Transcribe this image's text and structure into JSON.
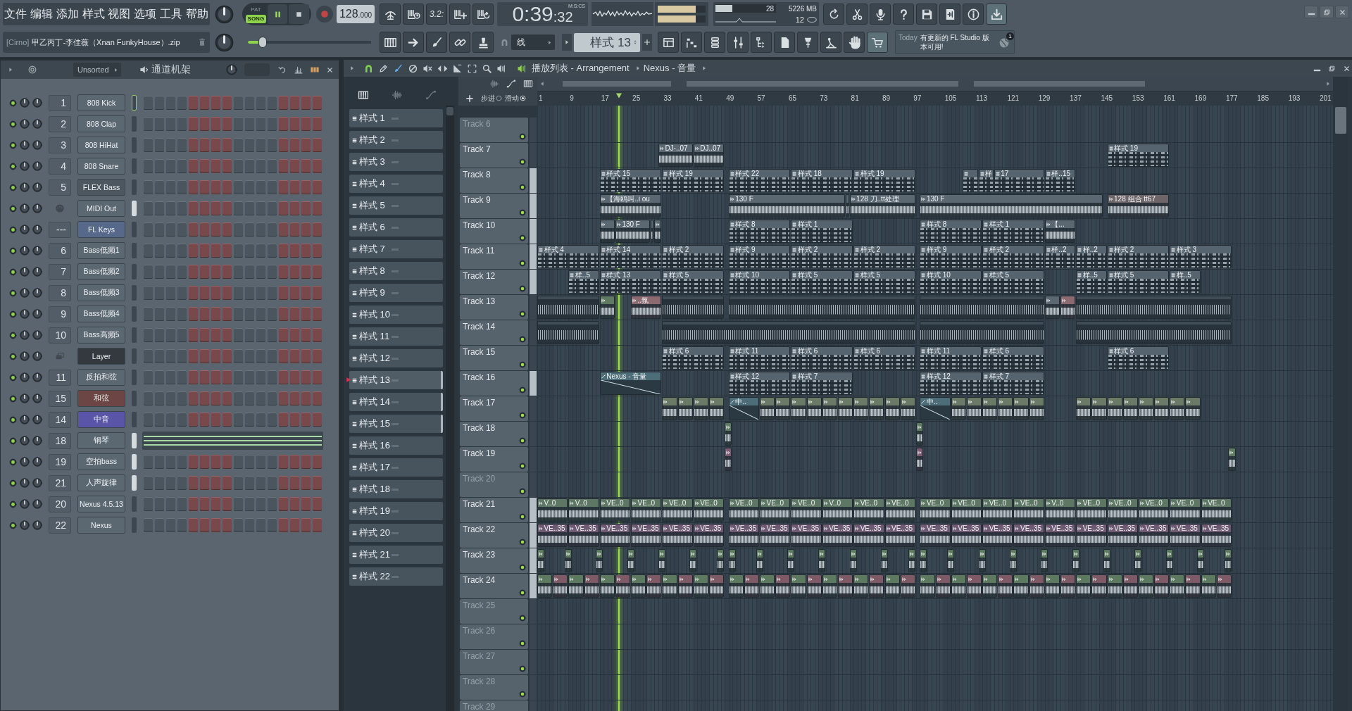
{
  "menu": [
    "文件",
    "编辑",
    "添加",
    "样式",
    "视图",
    "选项",
    "工具",
    "帮助"
  ],
  "hint": {
    "tag": "[Cirno]",
    "text": "甲乙丙丁-李佳薇（Xnan FunkyHouse）.zip"
  },
  "transport": {
    "modes": [
      {
        "label": "PAT",
        "selected": false
      },
      {
        "label": "SONG",
        "selected": true
      }
    ],
    "playing": true,
    "recording": false,
    "tempo": "128",
    "tempo_decimals": ".000"
  },
  "master_slider": {
    "level": 0.12
  },
  "countdown": "3.2:",
  "time": {
    "value": "0:39",
    "centiseconds": ":32",
    "format": "M:S:CS"
  },
  "output_meter": [
    {
      "level": 0.8
    },
    {
      "level": 0.8
    }
  ],
  "monitor": {
    "cpu": "28",
    "cpu_meter": {
      "level": 0.28
    },
    "memory": "5226 MB",
    "polyphony": "12"
  },
  "snap": "线",
  "pattern": "样式 13",
  "news": {
    "date": "Today",
    "message": "有更新的 FL Studio 版本可用!",
    "badge": "1"
  },
  "channel_rack": {
    "filter": "Unsorted",
    "title": "通道机架",
    "channels": [
      {
        "insert": "1",
        "name": "808 Kick",
        "kind": "channel",
        "color": "#5b6771",
        "on": true,
        "selected": false,
        "focused": true,
        "steps": [
          false,
          false,
          false,
          false,
          false,
          false,
          false,
          false,
          false,
          false,
          false,
          false,
          false,
          false,
          false,
          false
        ]
      },
      {
        "insert": "2",
        "name": "808 Clap",
        "kind": "channel",
        "color": "#5b6771",
        "on": true,
        "selected": false,
        "focused": false,
        "steps": [
          false,
          false,
          false,
          false,
          false,
          false,
          false,
          false,
          false,
          false,
          false,
          false,
          false,
          false,
          false,
          false
        ]
      },
      {
        "insert": "3",
        "name": "808 HiHat",
        "kind": "channel",
        "color": "#5b6771",
        "on": true,
        "selected": false,
        "focused": false,
        "steps": [
          false,
          false,
          false,
          false,
          false,
          false,
          false,
          false,
          false,
          false,
          false,
          false,
          false,
          false,
          false,
          false
        ]
      },
      {
        "insert": "4",
        "name": "808 Snare",
        "kind": "channel",
        "color": "#5b6771",
        "on": true,
        "selected": false,
        "focused": false,
        "steps": [
          false,
          false,
          false,
          false,
          false,
          false,
          false,
          false,
          false,
          false,
          false,
          false,
          false,
          false,
          false,
          false
        ]
      },
      {
        "insert": "5",
        "name": "FLEX Bass",
        "kind": "channel",
        "color": "#4d5760",
        "on": true,
        "selected": false,
        "focused": false,
        "steps": [
          false,
          false,
          false,
          false,
          false,
          false,
          false,
          false,
          false,
          false,
          false,
          false,
          false,
          false,
          false,
          false
        ]
      },
      {
        "name": "MIDI Out",
        "kind": "midi",
        "color": "#5b6771",
        "on": true,
        "selected": true,
        "focused": false,
        "steps": [
          false,
          false,
          false,
          false,
          false,
          false,
          false,
          false,
          false,
          false,
          false,
          false,
          false,
          false,
          false,
          false
        ]
      },
      {
        "insert": "---",
        "name": "FL Keys",
        "kind": "channel",
        "color": "#56698a",
        "on": true,
        "selected": false,
        "focused": false,
        "steps": [
          false,
          false,
          false,
          false,
          false,
          false,
          false,
          false,
          false,
          false,
          false,
          false,
          false,
          false,
          false,
          false
        ]
      },
      {
        "insert": "6",
        "name": "Bass低频1",
        "kind": "channel",
        "color": "#5b6771",
        "on": true,
        "selected": false,
        "focused": false,
        "steps": [
          false,
          false,
          false,
          false,
          false,
          false,
          false,
          false,
          false,
          false,
          false,
          false,
          false,
          false,
          false,
          false
        ]
      },
      {
        "insert": "7",
        "name": "Bass低频2",
        "kind": "channel",
        "color": "#5b6771",
        "on": true,
        "selected": false,
        "focused": false,
        "steps": [
          false,
          false,
          false,
          false,
          false,
          false,
          false,
          false,
          false,
          false,
          false,
          false,
          false,
          false,
          false,
          false
        ]
      },
      {
        "insert": "8",
        "name": "Bass低频3",
        "kind": "channel",
        "color": "#5b6771",
        "on": true,
        "selected": false,
        "focused": false,
        "steps": [
          false,
          false,
          false,
          false,
          false,
          false,
          false,
          false,
          false,
          false,
          false,
          false,
          false,
          false,
          false,
          false
        ]
      },
      {
        "insert": "9",
        "name": "Bass低频4",
        "kind": "channel",
        "color": "#5b6771",
        "on": true,
        "selected": false,
        "focused": false,
        "steps": [
          false,
          false,
          false,
          false,
          false,
          false,
          false,
          false,
          false,
          false,
          false,
          false,
          false,
          false,
          false,
          false
        ]
      },
      {
        "insert": "10",
        "name": "Bass高频5",
        "kind": "channel",
        "color": "#5b6771",
        "on": true,
        "selected": false,
        "focused": false,
        "steps": [
          false,
          false,
          false,
          false,
          false,
          false,
          false,
          false,
          false,
          false,
          false,
          false,
          false,
          false,
          false,
          false
        ]
      },
      {
        "name": "Layer",
        "kind": "layer",
        "color": "#33393f",
        "on": true,
        "selected": false,
        "focused": false,
        "steps": [
          false,
          false,
          false,
          false,
          false,
          false,
          false,
          false,
          false,
          false,
          false,
          false,
          false,
          false,
          false,
          false
        ]
      },
      {
        "insert": "11",
        "name": "反拍和弦",
        "kind": "channel",
        "color": "#5b6771",
        "on": true,
        "selected": false,
        "focused": false,
        "steps": [
          false,
          false,
          false,
          false,
          false,
          false,
          false,
          false,
          false,
          false,
          false,
          false,
          false,
          false,
          false,
          false
        ]
      },
      {
        "insert": "15",
        "name": "和弦",
        "kind": "channel",
        "color": "#6b4644",
        "on": true,
        "selected": false,
        "focused": false,
        "steps": [
          false,
          false,
          false,
          false,
          false,
          false,
          false,
          false,
          false,
          false,
          false,
          false,
          false,
          false,
          false,
          false
        ]
      },
      {
        "insert": "14",
        "name": "中音",
        "kind": "channel",
        "color": "#5b55a8",
        "on": true,
        "selected": false,
        "focused": false,
        "steps": [
          false,
          false,
          false,
          false,
          false,
          false,
          false,
          false,
          false,
          false,
          false,
          false,
          false,
          false,
          false,
          false
        ]
      },
      {
        "insert": "18",
        "name": "钢琴",
        "kind": "channel",
        "color": "#5b6771",
        "on": true,
        "selected": true,
        "focused": false,
        "piano_roll": true
      },
      {
        "insert": "19",
        "name": "空拍bass",
        "kind": "channel",
        "color": "#5b6771",
        "on": true,
        "selected": true,
        "focused": false,
        "steps": [
          false,
          false,
          false,
          false,
          false,
          false,
          false,
          false,
          false,
          false,
          false,
          false,
          false,
          false,
          false,
          false
        ]
      },
      {
        "insert": "21",
        "name": "人声旋律",
        "kind": "channel",
        "color": "#5b6771",
        "on": true,
        "selected": true,
        "focused": false,
        "steps": [
          false,
          false,
          false,
          false,
          false,
          false,
          false,
          false,
          false,
          false,
          false,
          false,
          false,
          false,
          false,
          false
        ]
      },
      {
        "insert": "20",
        "name": "Nexus 4.5.13",
        "kind": "channel",
        "color": "#5b6771",
        "on": true,
        "selected": false,
        "focused": false,
        "steps": [
          false,
          false,
          false,
          false,
          false,
          false,
          false,
          false,
          false,
          false,
          false,
          false,
          false,
          false,
          false,
          false
        ]
      },
      {
        "insert": "22",
        "name": "Nexus",
        "kind": "channel",
        "color": "#5b6771",
        "on": true,
        "selected": false,
        "focused": false,
        "steps": [
          false,
          false,
          false,
          false,
          false,
          false,
          false,
          false,
          false,
          false,
          false,
          false,
          false,
          false,
          false,
          false
        ]
      }
    ]
  },
  "playlist": {
    "title": "播放列表 - Arrangement",
    "crumb": "Nexus - 音量",
    "toggles": [
      {
        "label": "步进",
        "on": false
      },
      {
        "label": "滑动",
        "on": true
      }
    ],
    "patterns": [
      {
        "name": "样式 1",
        "selected": false,
        "marked": false
      },
      {
        "name": "样式 2",
        "selected": false,
        "marked": false
      },
      {
        "name": "样式 3",
        "selected": false,
        "marked": false
      },
      {
        "name": "样式 4",
        "selected": false,
        "marked": false
      },
      {
        "name": "样式 5",
        "selected": false,
        "marked": false
      },
      {
        "name": "样式 6",
        "selected": false,
        "marked": false
      },
      {
        "name": "样式 7",
        "selected": false,
        "marked": false
      },
      {
        "name": "样式 8",
        "selected": false,
        "marked": false
      },
      {
        "name": "样式 9",
        "selected": false,
        "marked": false
      },
      {
        "name": "样式 10",
        "selected": false,
        "marked": false
      },
      {
        "name": "样式 11",
        "selected": false,
        "marked": false
      },
      {
        "name": "样式 12",
        "selected": false,
        "marked": false
      },
      {
        "name": "样式 13",
        "selected": true,
        "marked": true
      },
      {
        "name": "样式 14",
        "selected": false,
        "marked": true
      },
      {
        "name": "样式 15",
        "selected": false,
        "marked": true
      },
      {
        "name": "样式 16",
        "selected": false,
        "marked": false
      },
      {
        "name": "样式 17",
        "selected": false,
        "marked": false
      },
      {
        "name": "样式 18",
        "selected": false,
        "marked": false
      },
      {
        "name": "样式 19",
        "selected": false,
        "marked": false
      },
      {
        "name": "样式 20",
        "selected": false,
        "marked": false
      },
      {
        "name": "样式 21",
        "selected": false,
        "marked": false
      },
      {
        "name": "样式 22",
        "selected": false,
        "marked": false
      }
    ],
    "ruler": [
      "1",
      "9",
      "17",
      "25",
      "33",
      "41",
      "49",
      "57",
      "65",
      "73",
      "81",
      "89",
      "97",
      "105",
      "113",
      "121",
      "129",
      "137",
      "145",
      "153",
      "161",
      "169",
      "177",
      "185",
      "193",
      "201"
    ],
    "tracks": [
      {
        "name": "Track 6",
        "on": true,
        "dimmed": true,
        "marked": false
      },
      {
        "name": "Track 7",
        "on": true,
        "dimmed": false,
        "marked": false,
        "clips": [
          {
            "kind": "audio",
            "label": "DJ-..07"
          },
          {
            "kind": "audio",
            "label": "DJ..07"
          },
          {
            "kind": "pattern",
            "label": "样式 19"
          }
        ]
      },
      {
        "name": "Track 8",
        "on": true,
        "dimmed": false,
        "marked": true,
        "clips": [
          {
            "kind": "pattern",
            "label": "样式 15"
          },
          {
            "kind": "pattern",
            "label": "样式 19"
          },
          {
            "kind": "pattern",
            "label": "样式 22"
          },
          {
            "kind": "pattern",
            "label": "样式 18"
          },
          {
            "kind": "pattern",
            "label": "样式 19"
          },
          {
            "kind": "pattern"
          },
          {
            "kind": "pattern",
            "label": "样"
          },
          {
            "kind": "pattern",
            "label": "17"
          },
          {
            "kind": "pattern",
            "label": "样..15"
          }
        ]
      },
      {
        "name": "Track 9",
        "on": true,
        "dimmed": false,
        "marked": true,
        "clips": [
          {
            "kind": "audio",
            "label": "【海鸥叫..i ou"
          },
          {
            "kind": "audio",
            "label": "130 F"
          },
          {
            "kind": "audio"
          },
          {
            "kind": "audio",
            "label": "128 刀..tt处理"
          },
          {
            "kind": "audio",
            "label": "130 F"
          },
          {
            "kind": "audio",
            "label": "128 组合 tt67",
            "color": "#6e6569"
          }
        ]
      },
      {
        "name": "Track 10",
        "on": true,
        "dimmed": false,
        "marked": true,
        "clips": [
          {
            "kind": "audio"
          },
          {
            "kind": "audio",
            "label": "130 F"
          },
          {
            "kind": "audio"
          },
          {
            "kind": "audio"
          },
          {
            "kind": "pattern",
            "label": "样式 8"
          },
          {
            "kind": "pattern",
            "label": "样式 1"
          },
          {
            "kind": "pattern",
            "label": "样式 8"
          },
          {
            "kind": "pattern",
            "label": "样式 1"
          },
          {
            "kind": "audio",
            "label": "【..."
          }
        ]
      },
      {
        "name": "Track 11",
        "on": true,
        "dimmed": false,
        "marked": true,
        "clips": [
          {
            "kind": "pattern",
            "label": "样式 4"
          },
          {
            "kind": "pattern",
            "label": "样式 14"
          },
          {
            "kind": "pattern",
            "label": "样式 2"
          },
          {
            "kind": "pattern",
            "label": "样式 9"
          },
          {
            "kind": "pattern",
            "label": "样式 2"
          },
          {
            "kind": "pattern",
            "label": "样式 2"
          },
          {
            "kind": "pattern",
            "label": "样式 9"
          },
          {
            "kind": "pattern",
            "label": "样式 2"
          },
          {
            "kind": "pattern",
            "label": "样..2"
          },
          {
            "kind": "pattern",
            "label": "样..2"
          },
          {
            "kind": "pattern",
            "label": "样式 2"
          },
          {
            "kind": "pattern",
            "label": "样式 3"
          }
        ]
      },
      {
        "name": "Track 12",
        "on": true,
        "dimmed": false,
        "marked": true,
        "clips": [
          {
            "kind": "pattern",
            "label": "样..5"
          },
          {
            "kind": "pattern",
            "label": "样式 13"
          },
          {
            "kind": "pattern",
            "label": "样式 5"
          },
          {
            "kind": "pattern",
            "label": "样式 10"
          },
          {
            "kind": "pattern",
            "label": "样式 5"
          },
          {
            "kind": "pattern",
            "label": "样式 5"
          },
          {
            "kind": "pattern",
            "label": "样式 10"
          },
          {
            "kind": "pattern",
            "label": "样式 5"
          },
          {
            "kind": "pattern",
            "label": "样..5"
          },
          {
            "kind": "pattern",
            "label": "样式 5"
          },
          {
            "kind": "pattern",
            "label": "样..5"
          }
        ]
      },
      {
        "name": "Track 13",
        "on": true,
        "dimmed": false,
        "marked": false,
        "clips": [
          {
            "kind": "sliced"
          },
          {
            "kind": "audio",
            "color": "#5f7a62"
          },
          {
            "kind": "audio",
            "label": "..氛",
            "color": "#8b6a72"
          },
          {
            "kind": "sliced"
          },
          {
            "kind": "sliced"
          },
          {
            "kind": "sliced"
          },
          {
            "kind": "audio"
          },
          {
            "kind": "audio",
            "color": "#8b6a72"
          },
          {
            "kind": "sliced"
          }
        ]
      },
      {
        "name": "Track 14",
        "on": true,
        "dimmed": false,
        "marked": false,
        "clips": [
          {
            "kind": "sliced"
          },
          {
            "kind": "sliced"
          },
          {
            "kind": "sliced"
          },
          {
            "kind": "sliced"
          }
        ]
      },
      {
        "name": "Track 15",
        "on": true,
        "dimmed": false,
        "marked": false,
        "clips": [
          {
            "kind": "pattern",
            "label": "样式 6"
          },
          {
            "kind": "pattern",
            "label": "样式 11"
          },
          {
            "kind": "pattern",
            "label": "样式 6"
          },
          {
            "kind": "pattern",
            "label": "样式 6"
          },
          {
            "kind": "pattern",
            "label": "样式 11"
          },
          {
            "kind": "pattern",
            "label": "样式 6"
          },
          {
            "kind": "pattern",
            "label": "样式 6"
          }
        ]
      },
      {
        "name": "Track 16",
        "on": true,
        "dimmed": false,
        "marked": true,
        "clips": [
          {
            "kind": "automation",
            "label": "Nexus - 音量"
          },
          {
            "kind": "pattern",
            "label": "样式 12"
          },
          {
            "kind": "pattern",
            "label": "样式 7"
          },
          {
            "kind": "pattern",
            "label": "样式 12"
          },
          {
            "kind": "pattern",
            "label": "样式 7"
          }
        ]
      },
      {
        "name": "Track 17",
        "on": true,
        "dimmed": false,
        "marked": false,
        "clips": [
          {
            "kind": "audio",
            "color": "#6a7a67"
          },
          {
            "kind": "audio",
            "color": "#6a7a67"
          },
          {
            "kind": "audio",
            "color": "#6a7a67"
          },
          {
            "kind": "audio",
            "color": "#6a7a67"
          },
          {
            "kind": "automation",
            "label": "中.."
          },
          {
            "kind": "audio",
            "color": "#6a7a67"
          },
          {
            "kind": "audio",
            "color": "#6a7a67"
          },
          {
            "kind": "audio",
            "color": "#6a7a67"
          },
          {
            "kind": "audio",
            "color": "#6a7a67"
          },
          {
            "kind": "audio",
            "color": "#6a7a67"
          },
          {
            "kind": "audio",
            "color": "#6a7a67"
          },
          {
            "kind": "audio",
            "color": "#6a7a67"
          },
          {
            "kind": "audio",
            "color": "#6a7a67"
          },
          {
            "kind": "audio",
            "color": "#6a7a67"
          },
          {
            "kind": "audio",
            "color": "#6a7a67"
          },
          {
            "kind": "automation",
            "label": "中.."
          },
          {
            "kind": "audio",
            "color": "#6a7a67"
          },
          {
            "kind": "audio",
            "color": "#6a7a67"
          },
          {
            "kind": "audio",
            "color": "#6a7a67"
          },
          {
            "kind": "audio",
            "color": "#6a7a67"
          },
          {
            "kind": "audio",
            "color": "#6a7a67"
          },
          {
            "kind": "audio",
            "color": "#6a7a67"
          },
          {
            "kind": "audio",
            "color": "#6a7a67"
          },
          {
            "kind": "audio",
            "color": "#6a7a67"
          },
          {
            "kind": "audio",
            "color": "#6a7a67"
          },
          {
            "kind": "audio",
            "color": "#6a7a67"
          },
          {
            "kind": "audio",
            "color": "#6a7a67"
          },
          {
            "kind": "audio",
            "color": "#6a7a67"
          },
          {
            "kind": "audio",
            "color": "#6a7a67"
          },
          {
            "kind": "audio",
            "color": "#6a7a67"
          }
        ]
      },
      {
        "name": "Track 18",
        "on": true,
        "dimmed": false,
        "marked": false,
        "clips": [
          {
            "kind": "audio",
            "color": "#5f7a62"
          },
          {
            "kind": "audio",
            "color": "#5f7a62"
          }
        ]
      },
      {
        "name": "Track 19",
        "on": true,
        "dimmed": false,
        "marked": false,
        "clips": [
          {
            "kind": "audio",
            "color": "#7c5b74"
          },
          {
            "kind": "audio",
            "color": "#7c5b74"
          },
          {
            "kind": "audio",
            "color": "#5f7a62"
          }
        ]
      },
      {
        "name": "Track 20",
        "on": true,
        "dimmed": true,
        "marked": false
      },
      {
        "name": "Track 21",
        "on": true,
        "dimmed": false,
        "marked": true,
        "clips": [
          {
            "kind": "audio",
            "label": "V..0",
            "color": "#5e7764"
          },
          {
            "kind": "audio",
            "label": "V..0",
            "color": "#5e7764"
          },
          {
            "kind": "audio",
            "label": "VE..0",
            "color": "#5e7764"
          },
          {
            "kind": "audio",
            "label": "VE..0",
            "color": "#5e7764"
          },
          {
            "kind": "audio",
            "label": "VE..0",
            "color": "#5e7764"
          },
          {
            "kind": "audio",
            "label": "VE..0",
            "color": "#5e7764"
          },
          {
            "kind": "audio",
            "label": "VE..0",
            "color": "#5e7764"
          },
          {
            "kind": "audio",
            "label": "VE..0",
            "color": "#5e7764"
          },
          {
            "kind": "audio",
            "label": "VE..0",
            "color": "#5e7764"
          },
          {
            "kind": "audio",
            "label": "V..0",
            "color": "#5e7764"
          },
          {
            "kind": "audio",
            "label": "VE..0",
            "color": "#5e7764"
          },
          {
            "kind": "audio",
            "label": "VE..0",
            "color": "#5e7764"
          },
          {
            "kind": "audio",
            "label": "VE..0",
            "color": "#5e7764"
          },
          {
            "kind": "audio",
            "label": "VE..0",
            "color": "#5e7764"
          },
          {
            "kind": "audio",
            "label": "VE..0",
            "color": "#5e7764"
          },
          {
            "kind": "audio",
            "label": "VE..0",
            "color": "#5e7764"
          },
          {
            "kind": "audio",
            "label": "V..0",
            "color": "#5e7764"
          },
          {
            "kind": "audio",
            "label": "VE..0",
            "color": "#5e7764"
          },
          {
            "kind": "audio",
            "label": "VE..0",
            "color": "#5e7764"
          },
          {
            "kind": "audio",
            "label": "VE..0",
            "color": "#5e7764"
          },
          {
            "kind": "audio",
            "label": "VE..0",
            "color": "#5e7764"
          },
          {
            "kind": "audio",
            "label": "VE..0",
            "color": "#5e7764"
          }
        ]
      },
      {
        "name": "Track 22",
        "on": true,
        "dimmed": false,
        "marked": true,
        "clips": [
          {
            "kind": "audio",
            "label": "VE..35",
            "color": "#6f5a73"
          },
          {
            "kind": "audio",
            "label": "VE..35",
            "color": "#6f5a73"
          },
          {
            "kind": "audio",
            "label": "VE..35",
            "color": "#6f5a73"
          },
          {
            "kind": "audio",
            "label": "VE..35",
            "color": "#6f5a73"
          },
          {
            "kind": "audio",
            "label": "VE..35",
            "color": "#6f5a73"
          },
          {
            "kind": "audio",
            "label": "VE..35",
            "color": "#6f5a73"
          },
          {
            "kind": "audio",
            "label": "VE..35",
            "color": "#6f5a73"
          },
          {
            "kind": "audio",
            "label": "VE..35",
            "color": "#6f5a73"
          },
          {
            "kind": "audio",
            "label": "VE..35",
            "color": "#6f5a73"
          },
          {
            "kind": "audio",
            "label": "VE..35",
            "color": "#6f5a73"
          },
          {
            "kind": "audio",
            "label": "VE..35",
            "color": "#6f5a73"
          },
          {
            "kind": "audio",
            "label": "VE..35",
            "color": "#6f5a73"
          },
          {
            "kind": "audio",
            "label": "VE..35",
            "color": "#6f5a73"
          },
          {
            "kind": "audio",
            "label": "VE..35",
            "color": "#6f5a73"
          },
          {
            "kind": "audio",
            "label": "VE..35",
            "color": "#6f5a73"
          },
          {
            "kind": "audio",
            "label": "VE..35",
            "color": "#6f5a73"
          },
          {
            "kind": "audio",
            "label": "VE..35",
            "color": "#6f5a73"
          },
          {
            "kind": "audio",
            "label": "VE..35",
            "color": "#6f5a73"
          },
          {
            "kind": "audio",
            "label": "VE..35",
            "color": "#6f5a73"
          },
          {
            "kind": "audio",
            "label": "VE..35",
            "color": "#6f5a73"
          },
          {
            "kind": "audio",
            "label": "VE..35",
            "color": "#6f5a73"
          },
          {
            "kind": "audio",
            "label": "VE..35",
            "color": "#6f5a73"
          }
        ]
      },
      {
        "name": "Track 23",
        "on": true,
        "dimmed": false,
        "marked": true,
        "clips": [
          {
            "kind": "audio",
            "color": "#5d7a60"
          },
          {
            "kind": "audio",
            "color": "#5d7a60"
          },
          {
            "kind": "audio",
            "color": "#5d7a60"
          },
          {
            "kind": "audio",
            "color": "#5d7a60"
          },
          {
            "kind": "audio",
            "color": "#5d7a60"
          },
          {
            "kind": "audio",
            "color": "#5d7a60"
          },
          {
            "kind": "audio",
            "color": "#5d7a60"
          },
          {
            "kind": "audio",
            "color": "#5d7a60"
          },
          {
            "kind": "audio",
            "color": "#5d7a60"
          },
          {
            "kind": "audio",
            "color": "#5d7a60"
          },
          {
            "kind": "audio",
            "color": "#5d7a60"
          },
          {
            "kind": "audio",
            "color": "#5d7a60"
          },
          {
            "kind": "audio",
            "color": "#5d7a60"
          },
          {
            "kind": "audio",
            "color": "#5d7a60"
          },
          {
            "kind": "audio",
            "color": "#5d7a60"
          },
          {
            "kind": "audio",
            "color": "#5d7a60"
          },
          {
            "kind": "audio",
            "color": "#5d7a60"
          },
          {
            "kind": "audio",
            "color": "#5d7a60"
          },
          {
            "kind": "audio",
            "color": "#5d7a60"
          },
          {
            "kind": "audio",
            "color": "#5d7a60"
          },
          {
            "kind": "audio",
            "color": "#5d7a60"
          },
          {
            "kind": "audio",
            "color": "#5d7a60"
          },
          {
            "kind": "audio",
            "color": "#5d7a60"
          },
          {
            "kind": "audio",
            "color": "#5d7a60"
          },
          {
            "kind": "audio",
            "color": "#5d7a60"
          }
        ]
      },
      {
        "name": "Track 24",
        "on": true,
        "dimmed": false,
        "marked": true,
        "clips": [
          {
            "kind": "audio",
            "color": "#5d7a60"
          },
          {
            "kind": "audio",
            "color": "#7e5a66"
          },
          {
            "kind": "audio",
            "color": "#5d7a60"
          },
          {
            "kind": "audio",
            "color": "#7e5a66"
          },
          {
            "kind": "audio",
            "color": "#5d7a60"
          },
          {
            "kind": "audio",
            "color": "#7e5a66"
          },
          {
            "kind": "audio",
            "color": "#5d7a60"
          },
          {
            "kind": "audio",
            "color": "#7e5a66"
          },
          {
            "kind": "audio",
            "color": "#5d7a60"
          },
          {
            "kind": "audio",
            "color": "#7e5a66"
          },
          {
            "kind": "audio",
            "color": "#5d7a60"
          },
          {
            "kind": "audio",
            "color": "#7e5a66"
          },
          {
            "kind": "audio",
            "color": "#5d7a60"
          },
          {
            "kind": "audio",
            "color": "#7e5a66"
          },
          {
            "kind": "audio",
            "color": "#5d7a60"
          },
          {
            "kind": "audio",
            "color": "#7e5a66"
          },
          {
            "kind": "audio",
            "color": "#5d7a60"
          },
          {
            "kind": "audio",
            "color": "#7e5a66"
          },
          {
            "kind": "audio",
            "color": "#5d7a60"
          },
          {
            "kind": "audio",
            "color": "#7e5a66"
          },
          {
            "kind": "audio",
            "color": "#5d7a60"
          },
          {
            "kind": "audio",
            "color": "#7e5a66"
          },
          {
            "kind": "audio",
            "color": "#5d7a60"
          },
          {
            "kind": "audio",
            "color": "#7e5a66"
          },
          {
            "kind": "audio",
            "color": "#5d7a60"
          },
          {
            "kind": "audio",
            "color": "#7e5a66"
          },
          {
            "kind": "audio",
            "color": "#5d7a60"
          },
          {
            "kind": "audio",
            "color": "#7e5a66"
          },
          {
            "kind": "audio",
            "color": "#5d7a60"
          },
          {
            "kind": "audio",
            "color": "#7e5a66"
          },
          {
            "kind": "audio",
            "color": "#5d7a60"
          },
          {
            "kind": "audio",
            "color": "#7e5a66"
          },
          {
            "kind": "audio",
            "color": "#5d7a60"
          },
          {
            "kind": "audio",
            "color": "#7e5a66"
          },
          {
            "kind": "audio",
            "color": "#5d7a60"
          },
          {
            "kind": "audio",
            "color": "#7e5a66"
          },
          {
            "kind": "audio",
            "color": "#5d7a60"
          },
          {
            "kind": "audio",
            "color": "#7e5a66"
          },
          {
            "kind": "audio",
            "color": "#5d7a60"
          },
          {
            "kind": "audio",
            "color": "#7e5a66"
          },
          {
            "kind": "audio",
            "color": "#5d7a60"
          },
          {
            "kind": "audio",
            "color": "#7e5a66"
          },
          {
            "kind": "audio",
            "color": "#5d7a60"
          },
          {
            "kind": "audio",
            "color": "#7e5a66"
          }
        ]
      },
      {
        "name": "Track 25",
        "on": true,
        "dimmed": true,
        "marked": false
      },
      {
        "name": "Track 26",
        "on": true,
        "dimmed": true,
        "marked": false
      },
      {
        "name": "Track 27",
        "on": true,
        "dimmed": true,
        "marked": false
      },
      {
        "name": "Track 28",
        "on": true,
        "dimmed": true,
        "marked": false
      },
      {
        "name": "Track 29",
        "dimmed": true,
        "marked": false
      }
    ]
  }
}
